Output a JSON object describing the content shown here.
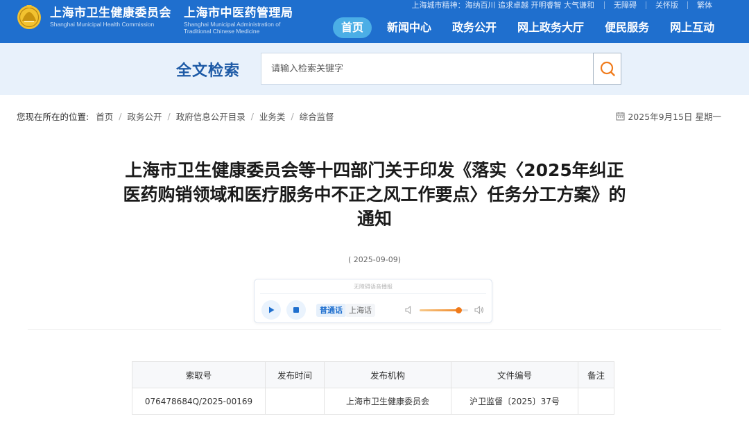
{
  "header": {
    "org1_cn": "上海市卫生健康委员会",
    "org1_en": "Shanghai Municipal Health Commission",
    "org2_cn": "上海市中医药管理局",
    "org2_en_line1": "Shanghai Municipal Administration of",
    "org2_en_line2": "Traditional Chinese Medicine",
    "logo_icon": "shanghai-emblem-logo",
    "city_spirit": "上海城市精神：海纳百川 追求卓越 开明睿智 大气谦和",
    "links": [
      "无障碍",
      "关怀版",
      "繁体"
    ],
    "nav": [
      "首页",
      "新闻中心",
      "政务公开",
      "网上政务大厅",
      "便民服务",
      "网上互动"
    ],
    "nav_active": "首页",
    "colors": {
      "brand": "#1f6fce",
      "nav_active": "#4baee6"
    }
  },
  "search": {
    "title": "全文检索",
    "placeholder": "请输入检索关键字",
    "button_icon": "search-icon",
    "button_color": "#f07a1a"
  },
  "breadcrumb": {
    "label": "您现在所在的位置:",
    "items": [
      "首页",
      "政务公开",
      "政府信息公开目录",
      "业务类",
      "综合监督"
    ],
    "date": "2025年9月15日 星期一",
    "date_icon": "calendar-icon"
  },
  "article": {
    "title_line1": "上海市卫生健康委员会等十四部门关于印发《落实〈2025年纠正",
    "title_line2": "医药购销领域和医疗服务中不正之风工作要点〉任务分工方案》的",
    "title_line3": "通知",
    "date": "( 2025-09-09)"
  },
  "player": {
    "caption": "无障碍语音播报",
    "play_icon": "play-icon",
    "stop_icon": "stop-icon",
    "lang_active": "普通话",
    "lang_other": "上海话",
    "volume_low_icon": "volume-low-icon",
    "volume_high_icon": "volume-high-icon",
    "volume_level": 0.8
  },
  "info_table": {
    "headers": [
      "索取号",
      "发布时间",
      "发布机构",
      "文件编号",
      "备注"
    ],
    "row": [
      "076478684Q/2025-00169",
      "",
      "上海市卫生健康委员会",
      "沪卫监督〔2025〕37号",
      ""
    ]
  }
}
